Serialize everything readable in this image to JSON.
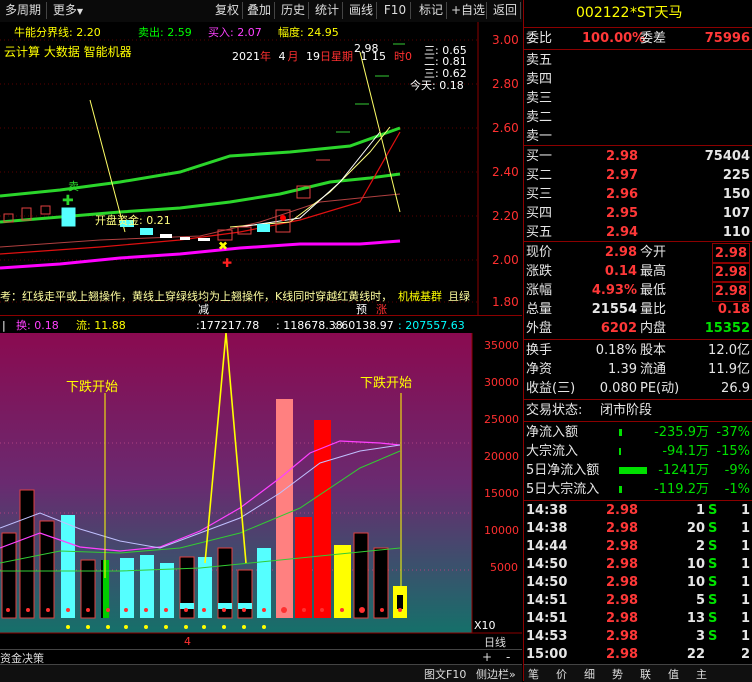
{
  "toolbar": {
    "period": "多周期",
    "more": "更多",
    "buttons": [
      "复权",
      "叠加",
      "历史",
      "统计",
      "画线",
      "F10",
      "标记",
      "+自选",
      "返回"
    ]
  },
  "main_chart": {
    "indicator_labels": {
      "bull": "牛能分界线: 2.20",
      "sell": "卖出: 2.59",
      "buy": "买入: 2.07",
      "amp": "幅度: 24.95"
    },
    "tags": "云计算 大数据 智能机器",
    "date": {
      "year": "2021",
      "y_unit": "年",
      "month": "4",
      "m_unit": "月",
      "day": "19",
      "d_unit": "日",
      "weekday": "星期",
      "wd": "1"
    },
    "time_overlay": {
      "left": "2.98",
      "mid": "15",
      "right": "时0"
    },
    "right_info": [
      "三: 0.65",
      "二: 0.81",
      "三: 0.62",
      "今天: 0.18"
    ],
    "sell_label": "卖",
    "kaipan_label": "开盘资金: 0.21",
    "ticker_text": "考：红线走平或上翘操作，黄线上穿绿线均为上翘操作，K线同时穿越红黄线时，",
    "ticker_tail": "机械基群",
    "ticker_end": "且绿",
    "y_axis": [
      "3.00",
      "2.80",
      "2.60",
      "2.40",
      "2.20",
      "2.00",
      "1.80"
    ],
    "bottom_marks": [
      "减",
      "预",
      "涨"
    ]
  },
  "volume_panel": {
    "header": {
      "a": "|",
      "huan": "换: 0.18",
      "liu": "流: 11.88",
      "nums": [
        ":177217.78",
        ": 118678.38",
        ": 60138.97",
        ": 207557.63"
      ]
    },
    "left_annot": "下跌开始",
    "right_annot": "下跌开始",
    "y_axis": [
      "35000",
      "30000",
      "25000",
      "20000",
      "15000",
      "10000",
      "5000"
    ],
    "x_label": "4",
    "zoom": "X10"
  },
  "bottom": {
    "strategy": "资金决策",
    "rixian": "日线",
    "plus": "+",
    "minus": "-",
    "tabs_right": [
      "图文F10",
      "侧边栏»"
    ],
    "rtabs": [
      "笔",
      "价",
      "细",
      "势",
      "联",
      "值",
      "主"
    ]
  },
  "quote": {
    "code": "002122",
    "name": "*ST天马",
    "weibi_label": "委比",
    "weibi": "100.00%",
    "weicha_label": "委差",
    "weicha": "75996",
    "asks": [
      {
        "label": "卖五",
        "price": "",
        "vol": ""
      },
      {
        "label": "卖四",
        "price": "",
        "vol": ""
      },
      {
        "label": "卖三",
        "price": "",
        "vol": ""
      },
      {
        "label": "卖二",
        "price": "",
        "vol": ""
      },
      {
        "label": "卖一",
        "price": "",
        "vol": ""
      }
    ],
    "bids": [
      {
        "label": "买一",
        "price": "2.98",
        "vol": "75404"
      },
      {
        "label": "买二",
        "price": "2.97",
        "vol": "225"
      },
      {
        "label": "买三",
        "price": "2.96",
        "vol": "150"
      },
      {
        "label": "买四",
        "price": "2.95",
        "vol": "107"
      },
      {
        "label": "买五",
        "price": "2.94",
        "vol": "110"
      }
    ],
    "stats": [
      {
        "l": "现价",
        "v": "2.98",
        "l2": "今开",
        "v2": "2.98"
      },
      {
        "l": "涨跌",
        "v": "0.14",
        "l2": "最高",
        "v2": "2.98"
      },
      {
        "l": "涨幅",
        "v": "4.93%",
        "l2": "最低",
        "v2": "2.98"
      },
      {
        "l": "总量",
        "v": "21554",
        "l2": "量比",
        "v2": "0.18"
      },
      {
        "l": "外盘",
        "v": "6202",
        "l2": "内盘",
        "v2": "15352"
      }
    ],
    "stats2": [
      {
        "l": "换手",
        "v": "0.18%",
        "l2": "股本",
        "v2": "12.0亿"
      },
      {
        "l": "净资",
        "v": "1.39",
        "l2": "流通",
        "v2": "11.9亿"
      },
      {
        "l": "收益(三)",
        "v": "0.080",
        "l2": "PE(动)",
        "v2": "26.9"
      }
    ],
    "status_label": "交易状态:",
    "status": "闭市阶段",
    "flows": [
      {
        "l": "净流入额",
        "v": "-235.9万",
        "p": "-37%"
      },
      {
        "l": "大宗流入",
        "v": "-94.1万",
        "p": "-15%"
      },
      {
        "l": "5日净流入额",
        "v": "-1241万",
        "p": "-9%"
      },
      {
        "l": "5日大宗流入",
        "v": "-119.2万",
        "p": "-1%"
      }
    ],
    "ticks": [
      {
        "t": "14:38",
        "p": "2.98",
        "v": "1",
        "s": "S",
        "n": "1"
      },
      {
        "t": "14:38",
        "p": "2.98",
        "v": "20",
        "s": "S",
        "n": "1"
      },
      {
        "t": "14:44",
        "p": "2.98",
        "v": "2",
        "s": "S",
        "n": "1"
      },
      {
        "t": "14:50",
        "p": "2.98",
        "v": "10",
        "s": "S",
        "n": "1"
      },
      {
        "t": "14:50",
        "p": "2.98",
        "v": "10",
        "s": "S",
        "n": "1"
      },
      {
        "t": "14:51",
        "p": "2.98",
        "v": "5",
        "s": "S",
        "n": "1"
      },
      {
        "t": "14:51",
        "p": "2.98",
        "v": "13",
        "s": "S",
        "n": "1"
      },
      {
        "t": "14:53",
        "p": "2.98",
        "v": "3",
        "s": "S",
        "n": "1"
      },
      {
        "t": "15:00",
        "p": "2.98",
        "v": "22",
        "s": "",
        "n": "2"
      }
    ]
  }
}
